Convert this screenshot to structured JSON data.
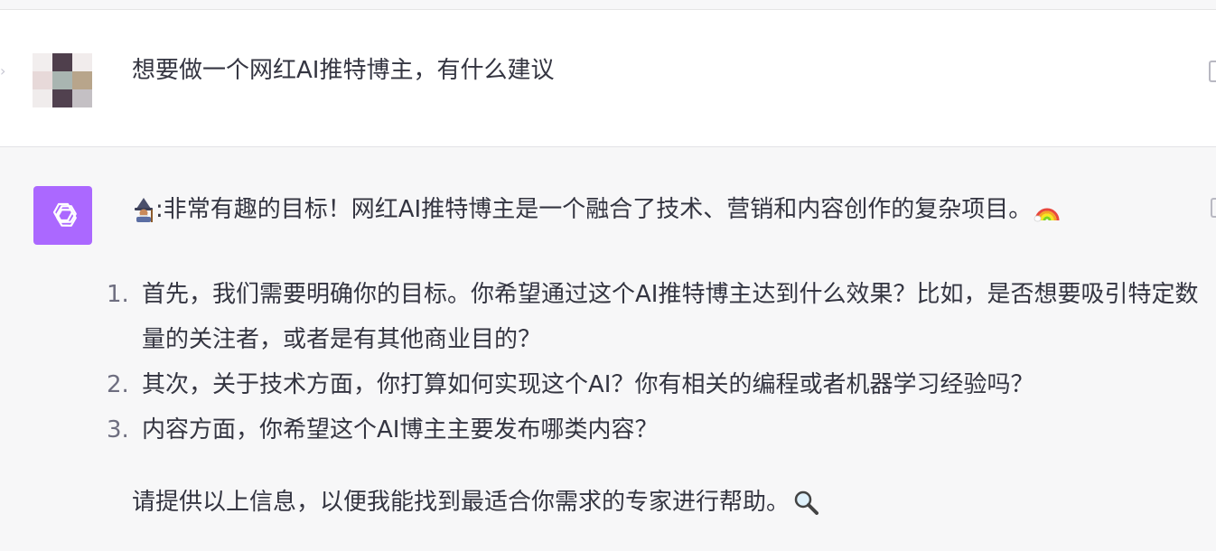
{
  "user_message": {
    "text": "想要做一个网红AI推特博主，有什么建议"
  },
  "assistant_message": {
    "intro_prefix": ":",
    "intro_text": "非常有趣的目标！网红AI推特博主是一个融合了技术、营销和内容创作的复杂项目。",
    "intro_lead_emoji": "wizard-emoji",
    "intro_trail_emoji": "rainbow-emoji",
    "list": [
      {
        "number": "1.",
        "text": "首先，我们需要明确你的目标。你希望通过这个AI推特博主达到什么效果？比如，是否想要吸引特定数量的关注者，或者是有其他商业目的？"
      },
      {
        "number": "2.",
        "text": "其次，关于技术方面，你打算如何实现这个AI？你有相关的编程或者机器学习经验吗？"
      },
      {
        "number": "3.",
        "text": "内容方面，你希望这个AI博主主要发布哪类内容？"
      }
    ],
    "outro_text": "请提供以上信息，以便我能找到最适合你需求的专家进行帮助。",
    "outro_emoji": "magnifier-emoji"
  },
  "colors": {
    "assistant_avatar_bg": "#ab68ff",
    "user_row_bg": "#ffffff",
    "assistant_row_bg": "#f7f7f8",
    "text": "#343541",
    "list_number": "#6e6e80"
  }
}
